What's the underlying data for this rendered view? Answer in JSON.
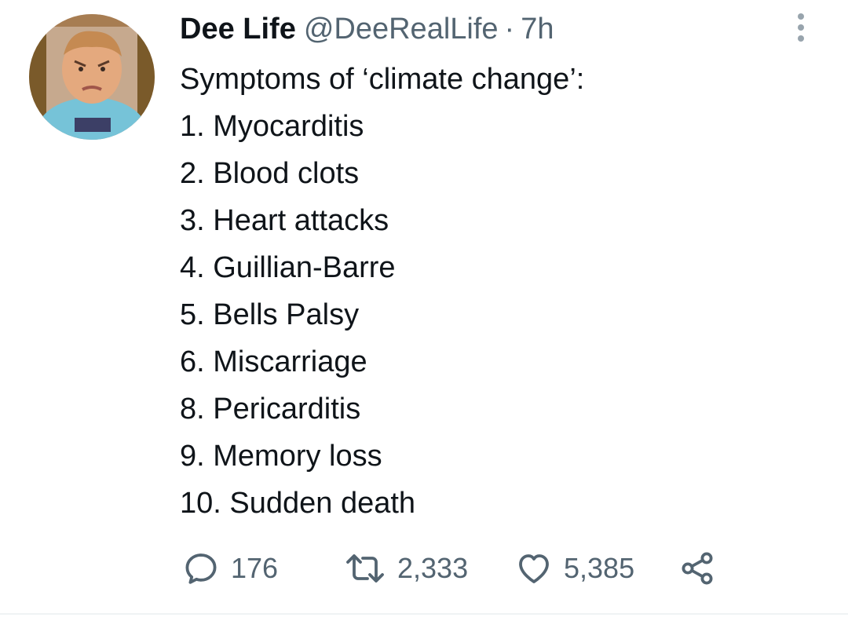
{
  "tweet": {
    "author_name": "Dee Life",
    "handle": "@DeeRealLife",
    "separator": "·",
    "time": "7h",
    "lines": [
      "Symptoms of ‘climate change’:",
      "1. Myocarditis",
      "2. Blood clots",
      "3. Heart attacks",
      "4. Guillian-Barre",
      "5. Bells Palsy",
      "6. Miscarriage",
      "8. Pericarditis",
      "9. Memory loss",
      "10. Sudden death"
    ]
  },
  "actions": {
    "reply_count": "176",
    "retweet_count": "2,333",
    "like_count": "5,385"
  },
  "icons": {
    "reply": "reply-icon",
    "retweet": "retweet-icon",
    "like": "heart-icon",
    "share": "share-icon",
    "more": "more-vertical-icon"
  },
  "colors": {
    "text_primary": "#0f1419",
    "text_secondary": "#536471",
    "divider": "#eff3f4"
  }
}
